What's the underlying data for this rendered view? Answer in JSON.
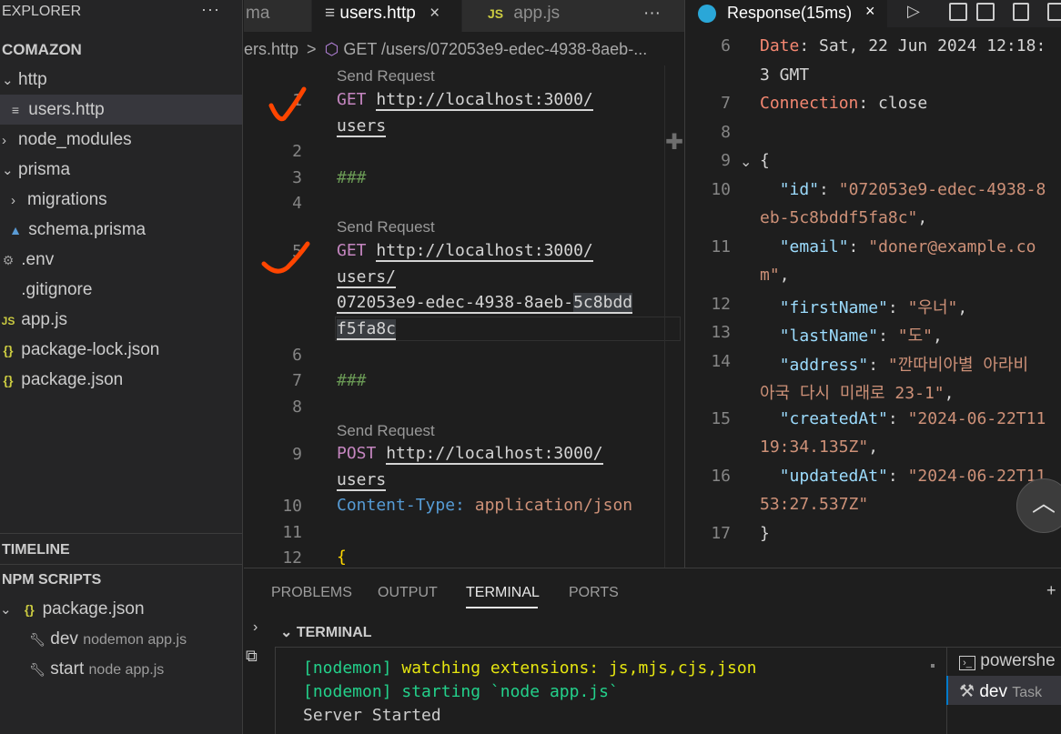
{
  "sidebar": {
    "title": "EXPLORER",
    "more": "···",
    "root": "COMAZON",
    "tree": [
      {
        "label": "http",
        "icon": "chevron-down-icon"
      },
      {
        "label": "users.http",
        "icon": "file-lines-icon"
      },
      {
        "label": "node_modules",
        "icon": "chevron-right-icon"
      },
      {
        "label": "prisma",
        "icon": "chevron-down-icon"
      },
      {
        "label": "migrations",
        "icon": "chevron-right-icon"
      },
      {
        "label": "schema.prisma",
        "icon": "prisma-triangle-icon"
      },
      {
        "label": ".env",
        "icon": "gear-icon"
      },
      {
        "label": ".gitignore",
        "icon": "file-icon"
      },
      {
        "label": "app.js",
        "icon": "js-icon",
        "icon_text": "JS"
      },
      {
        "label": "package-lock.json",
        "icon": "json-braces-icon",
        "icon_text": "{}"
      },
      {
        "label": "package.json",
        "icon": "json-braces-icon",
        "icon_text": "{}"
      }
    ],
    "timeline": "TIMELINE",
    "npm_scripts": "NPM SCRIPTS",
    "npm": {
      "file_icon_text": "{}",
      "file": "package.json",
      "scripts": [
        {
          "name": "dev",
          "cmd": "nodemon app.js"
        },
        {
          "name": "start",
          "cmd": "node app.js"
        }
      ]
    }
  },
  "tabs": {
    "prev_fragment": "ma",
    "active": "users.http",
    "close": "×",
    "other_icon_text": "JS",
    "other": "app.js",
    "more": "···"
  },
  "breadcrumb": {
    "file": "ers.http",
    "sep": ">",
    "request": "GET /users/072053e9-edec-4938-8aeb-..."
  },
  "editor": {
    "lens": "Send Request",
    "req1": {
      "method": "GET",
      "url_a": "http://localhost:3000/",
      "url_b": "users"
    },
    "sep": "###",
    "req2": {
      "method": "GET",
      "url_a": "http://localhost:3000/",
      "url_b": "users/",
      "url_c1": "072053e9-edec-4938-8aeb-",
      "url_c2": "5c8bdd",
      "url_d": "f5fa8c"
    },
    "req3": {
      "method": "POST",
      "url_a": "http://localhost:3000/",
      "url_b": "users",
      "header_key": "Content-Type:",
      "header_val": "application/json"
    },
    "brace": "{",
    "line_numbers": [
      "1",
      "2",
      "3",
      "4",
      "5",
      "6",
      "7",
      "8",
      "9",
      "10",
      "11",
      "12"
    ]
  },
  "response": {
    "tab": "Response(15ms)",
    "close": "×",
    "line_numbers": [
      "6",
      "7",
      "8",
      "9",
      "10",
      "11",
      "12",
      "13",
      "14",
      "15",
      "16",
      "17"
    ],
    "lines": {
      "date_key": "Date",
      "date_val_a": ": Sat, 22 Jun 2024 12:18:",
      "date_val_b": "3 GMT",
      "conn_key": "Connection",
      "conn_val": ": close",
      "open_brace": "{",
      "id_key": "\"id\"",
      "id_val_a": "\"072053e9-edec-4938-8",
      "id_val_b": "eb-5c8bddf5fa8c\"",
      "email_key": "\"email\"",
      "email_val_a": "\"doner@example.co",
      "email_val_b": "m\"",
      "first_key": "\"firstName\"",
      "first_val": "\"우너\"",
      "last_key": "\"lastName\"",
      "last_val": "\"도\"",
      "addr_key": "\"address\"",
      "addr_val_a": "\"깐따비아별 아라비",
      "addr_val_b": "아국 다시 미래로 23-1\"",
      "created_key": "\"createdAt\"",
      "created_val_a": "\"2024-06-22T11",
      "created_val_b": "19:34.135Z\"",
      "updated_key": "\"updatedAt\"",
      "updated_val_a": "\"2024-06-22T11",
      "updated_val_b": "53:27.537Z\"",
      "close_brace": "}"
    }
  },
  "panel": {
    "tabs": [
      "PROBLEMS",
      "OUTPUT",
      "TERMINAL",
      "PORTS"
    ],
    "terminal_title": "TERMINAL",
    "lines": [
      {
        "prefix": "[nodemon]",
        "text": " watching extensions: js,mjs,cjs,json"
      },
      {
        "prefix": "[nodemon]",
        "text": " starting `node app.js`"
      },
      {
        "prefix": "",
        "text": "Server Started"
      }
    ],
    "sessions": [
      {
        "name": "powershe",
        "detail": ""
      },
      {
        "name": "dev",
        "detail": "Task"
      }
    ]
  },
  "colors": {
    "accent": "#007acc",
    "annotation_check": "#ff4500"
  }
}
